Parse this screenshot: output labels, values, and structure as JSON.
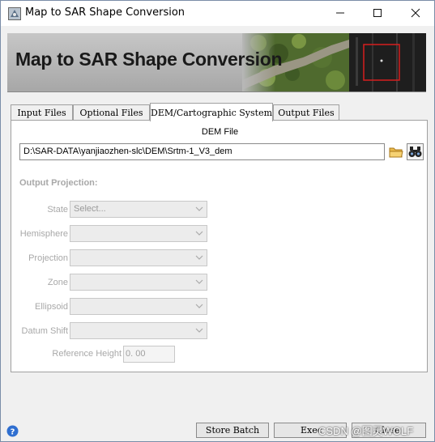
{
  "window": {
    "title": "Map to SAR Shape Conversion"
  },
  "banner": {
    "title": "Map to SAR Shape Conversion"
  },
  "tabs": [
    {
      "label": "Input Files",
      "active": false
    },
    {
      "label": "Optional Files",
      "active": false
    },
    {
      "label": "DEM/Cartographic System",
      "active": true
    },
    {
      "label": "Output Files",
      "active": false
    }
  ],
  "dem": {
    "label": "DEM File",
    "path": "D:\\SAR-DATA\\yanjiaozhen-slc\\DEM\\Srtm-1_V3_dem"
  },
  "projection": {
    "header": "Output Projection:",
    "fields": [
      {
        "label": "State",
        "value": "Select..."
      },
      {
        "label": "Hemisphere",
        "value": ""
      },
      {
        "label": "Projection",
        "value": ""
      },
      {
        "label": "Zone",
        "value": ""
      },
      {
        "label": "Ellipsoid",
        "value": ""
      },
      {
        "label": "Datum Shift",
        "value": ""
      }
    ],
    "reference_height_label": "Reference Height",
    "reference_height_value": "0. 00"
  },
  "footer": {
    "store_batch": "Store Batch",
    "execute": "Exec",
    "close": "Close",
    "watermark": "CSDN @图灵WOLF"
  },
  "colors": {
    "tab_active_bg": "#ffffff",
    "disabled_text": "#a8a8a8",
    "window_bg": "#f0f0f0"
  }
}
